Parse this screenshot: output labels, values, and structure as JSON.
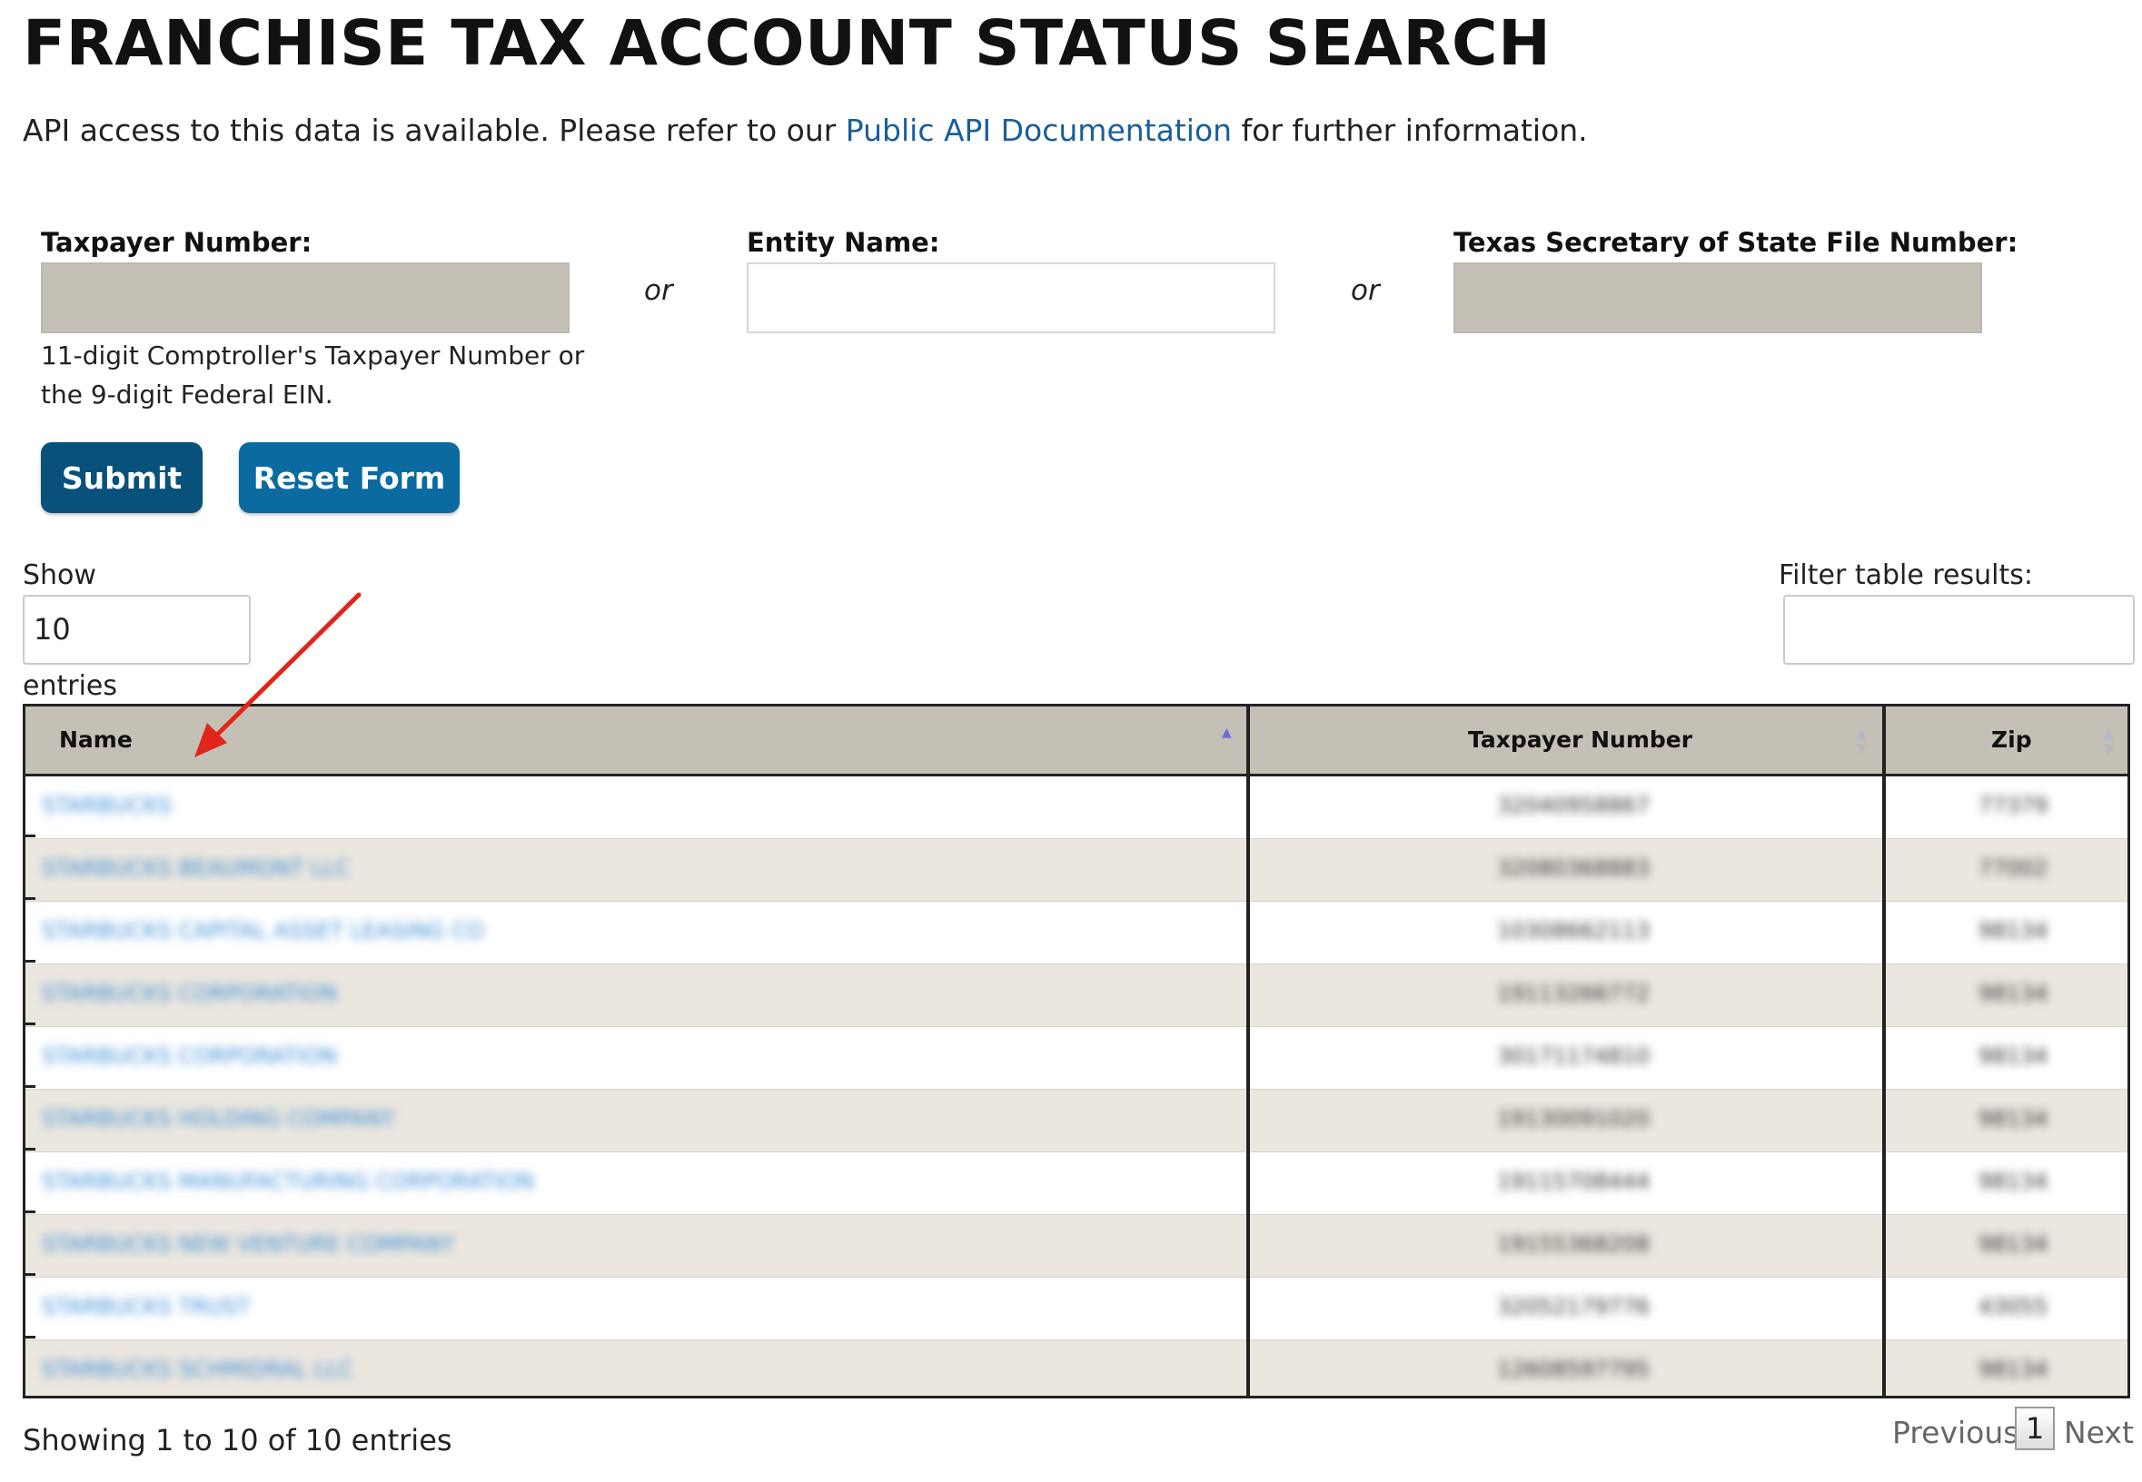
{
  "title": "FRANCHISE TAX ACCOUNT STATUS SEARCH",
  "api_notice": {
    "before": "API access to this data is available. Please refer to our ",
    "link": "Public API Documentation",
    "after": " for further information."
  },
  "form": {
    "taxpayer_label": "Taxpayer Number:",
    "entity_label": "Entity Name:",
    "sos_label": "Texas Secretary of State File Number:",
    "or": "or",
    "hint": "11-digit Comptroller's Taxpayer Number or the 9-digit Federal EIN.",
    "submit_label": "Submit",
    "reset_label": "Reset Form"
  },
  "table_controls": {
    "show_label": "Show",
    "page_size": "10",
    "entries_label": "entries",
    "filter_label": "Filter table results:"
  },
  "table": {
    "columns": [
      "Name",
      "Taxpayer Number",
      "Zip"
    ],
    "rows": [
      {
        "name": "STARBUCKS",
        "taxpayer": "32040958867",
        "zip": "77379"
      },
      {
        "name": "STARBUCKS BEAUMONT LLC",
        "taxpayer": "32080368883",
        "zip": "77002"
      },
      {
        "name": "STARBUCKS CAPITAL ASSET LEASING CO",
        "taxpayer": "10308662113",
        "zip": "98134"
      },
      {
        "name": "STARBUCKS CORPORATION",
        "taxpayer": "19113266772",
        "zip": "98134"
      },
      {
        "name": "STARBUCKS CORPORATION",
        "taxpayer": "30171174810",
        "zip": "98134"
      },
      {
        "name": "STARBUCKS HOLDING COMPANY",
        "taxpayer": "19130091020",
        "zip": "98134"
      },
      {
        "name": "STARBUCKS MANUFACTURING CORPORATION",
        "taxpayer": "19115708444",
        "zip": "98134"
      },
      {
        "name": "STARBUCKS NEW VENTURE COMPANY",
        "taxpayer": "19155368208",
        "zip": "98134"
      },
      {
        "name": "STARBUCKS TRUST",
        "taxpayer": "32052179776",
        "zip": "43055"
      },
      {
        "name": "STARBUCKS SCHMIDRAL LLC",
        "taxpayer": "12608597795",
        "zip": "98134"
      }
    ]
  },
  "footer": {
    "info": "Showing 1 to 10 of 10 entries",
    "previous": "Previous",
    "page": "1",
    "next": "Next"
  },
  "colors": {
    "header_bg": "#c4c0b5",
    "link": "#1a5e9a",
    "submit": "#07517a",
    "reset": "#0b6aa0",
    "annotation_arrow": "#e0261b"
  }
}
